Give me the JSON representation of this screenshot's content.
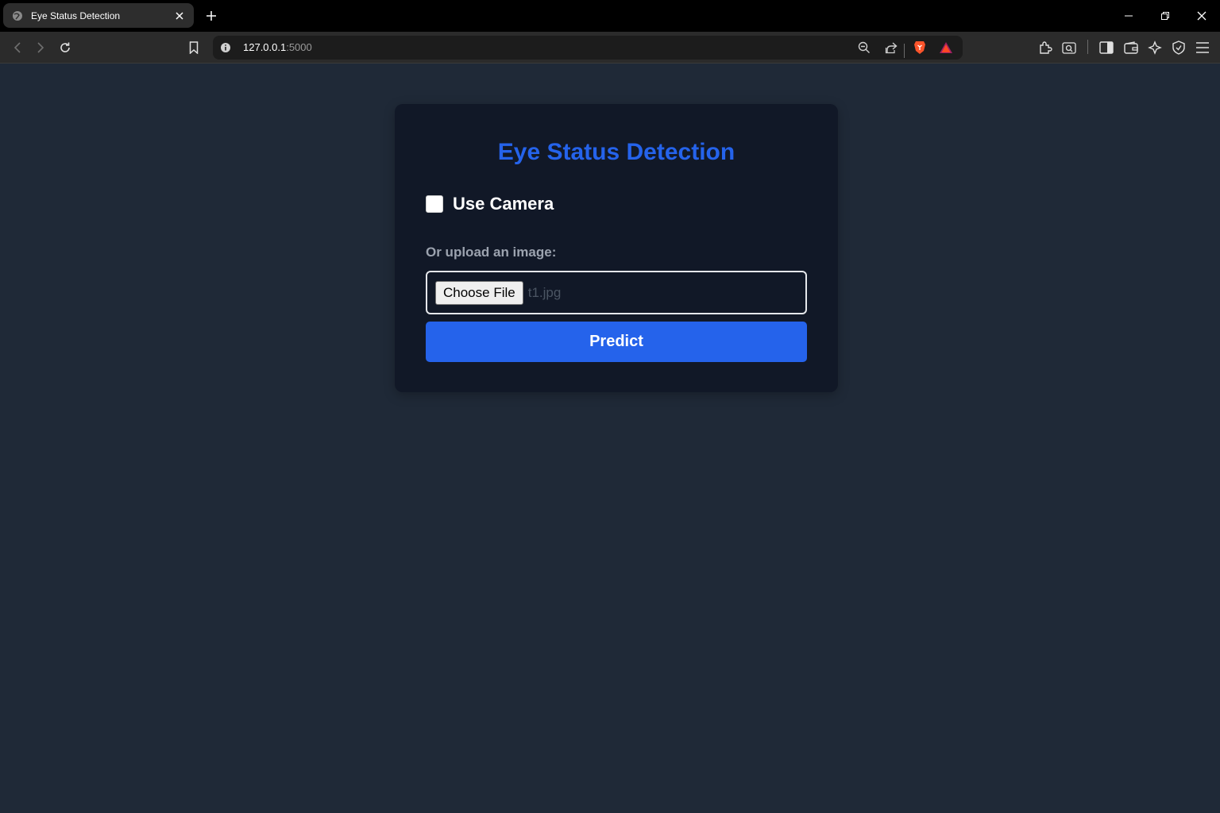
{
  "browser": {
    "tab": {
      "title": "Eye Status Detection"
    },
    "address_bar": {
      "host": "127.0.0.1",
      "port": ":5000"
    }
  },
  "page": {
    "title": "Eye Status Detection",
    "camera_checkbox": {
      "label": "Use Camera",
      "checked": false
    },
    "upload": {
      "label": "Or upload an image:",
      "button_label": "Choose File",
      "file_name": "t1.jpg"
    },
    "predict_label": "Predict"
  },
  "colors": {
    "page_background": "#1f2937",
    "card_background": "#111827",
    "accent": "#2563eb",
    "muted_text": "#9ca3af"
  }
}
